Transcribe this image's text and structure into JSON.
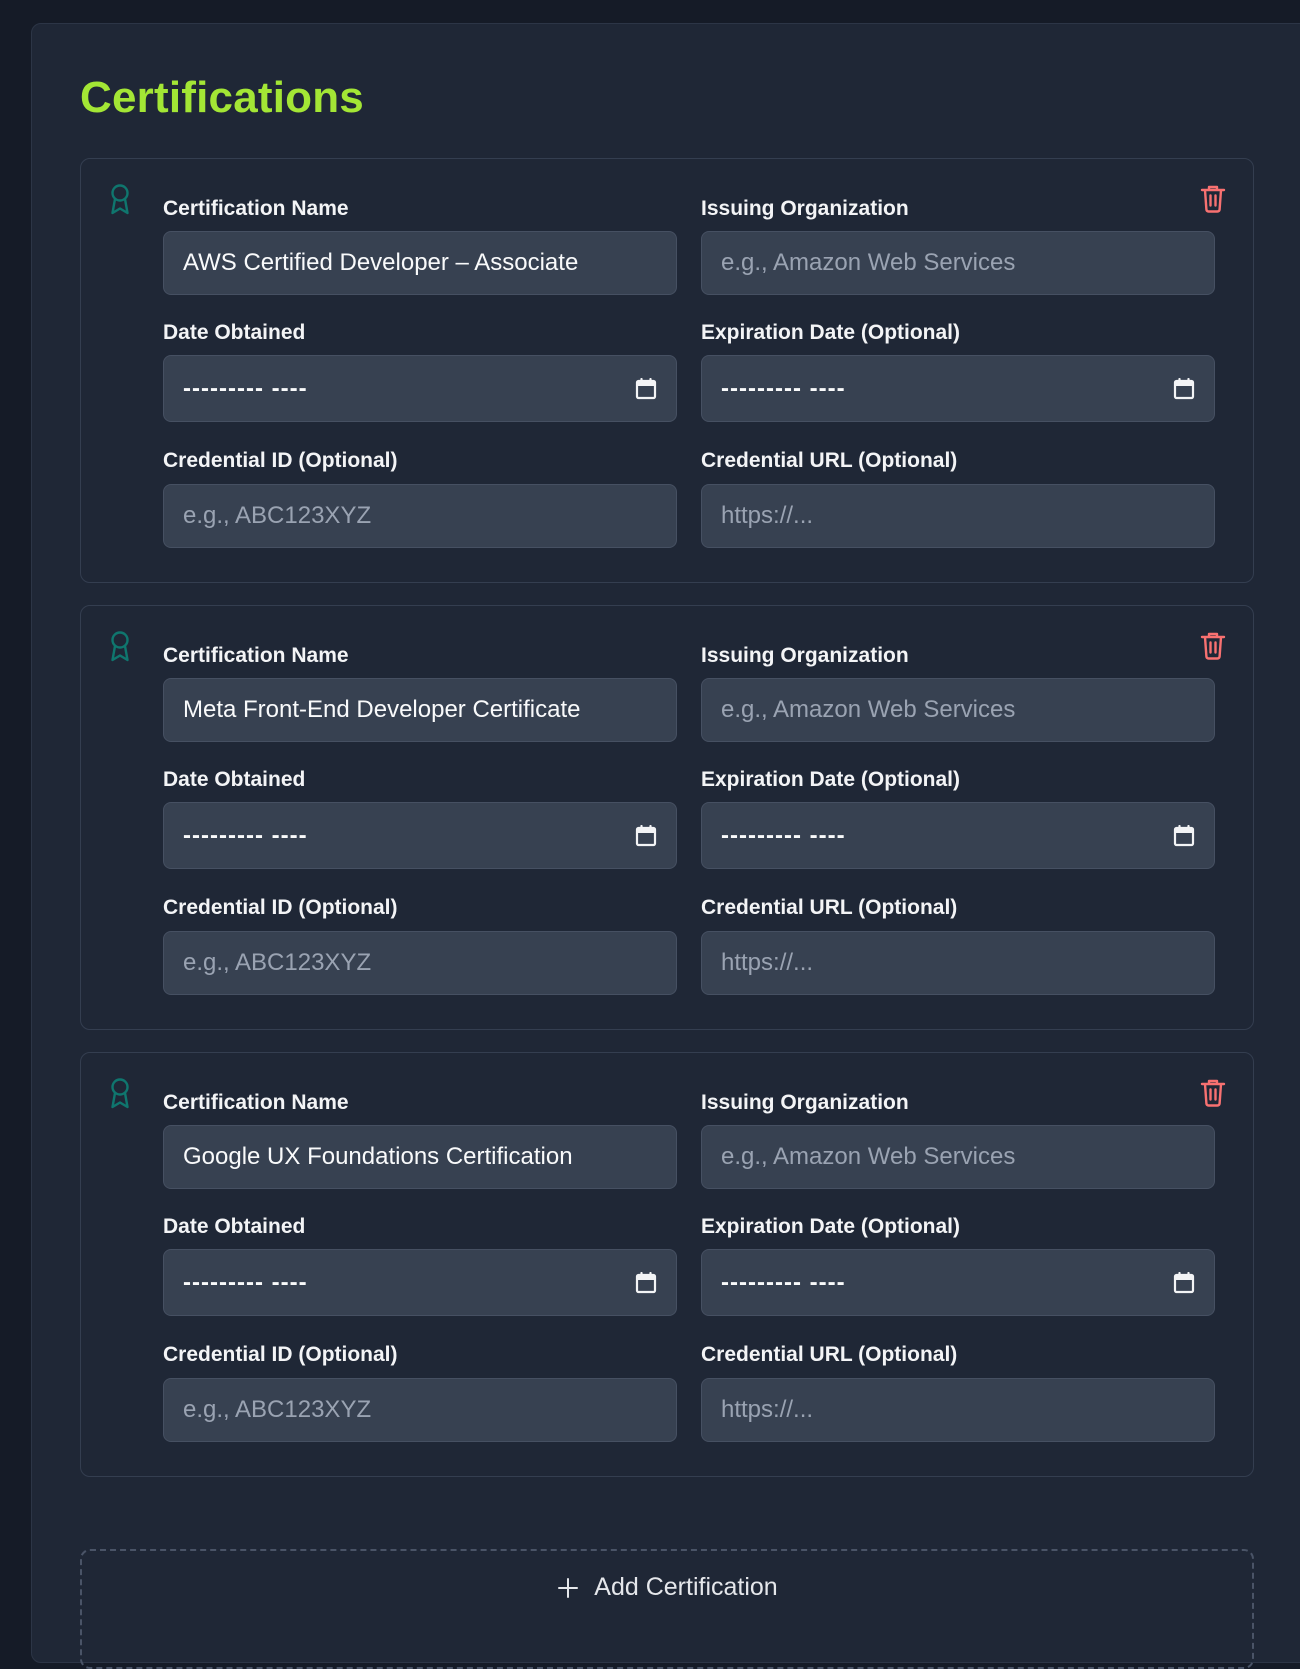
{
  "section": {
    "title": "Certifications",
    "add_label": "Add Certification"
  },
  "labels": {
    "name": "Certification Name",
    "org": "Issuing Organization",
    "date_obtained": "Date Obtained",
    "expiration": "Expiration Date (Optional)",
    "credential_id": "Credential ID (Optional)",
    "credential_url": "Credential URL (Optional)"
  },
  "placeholders": {
    "org": "e.g., Amazon Web Services",
    "credential_id": "e.g., ABC123XYZ",
    "credential_url": "https://...",
    "date": "--------- ----"
  },
  "certifications": [
    {
      "name": "AWS Certified Developer – Associate"
    },
    {
      "name": "Meta Front-End Developer Certificate"
    },
    {
      "name": "Google UX Foundations Certification"
    }
  ],
  "colors": {
    "accent": "#a3e635",
    "delete": "#f87171",
    "icon": "#0f766e"
  },
  "icons": {
    "card": "award-icon",
    "delete": "trash-icon",
    "date": "calendar-icon",
    "add": "plus-icon"
  }
}
